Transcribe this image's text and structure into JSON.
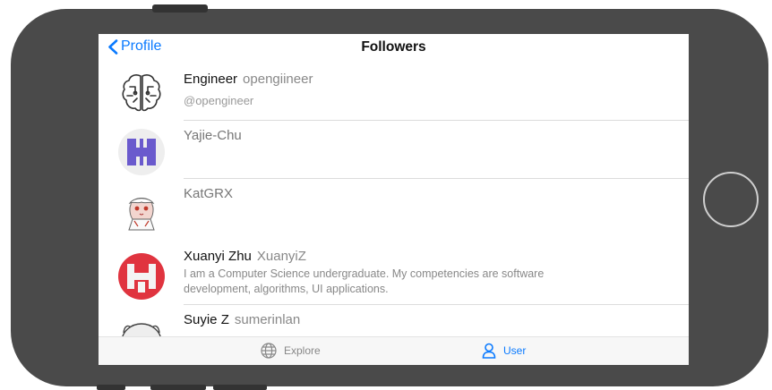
{
  "nav": {
    "back_label": "Profile",
    "title": "Followers"
  },
  "followers": [
    {
      "name": "Engineer",
      "login": "opengiineer",
      "subtitle": "@opengineer",
      "bio": ""
    },
    {
      "name": "Yajie-Chu",
      "login": "",
      "subtitle": "",
      "bio": ""
    },
    {
      "name": "KatGRX",
      "login": "",
      "subtitle": "",
      "bio": ""
    },
    {
      "name": "Xuanyi Zhu",
      "login": "XuanyiZ",
      "subtitle": "",
      "bio": "I am a Computer Science undergraduate. My competencies are software development, algorithms, UI applications."
    },
    {
      "name": "Suyie Z",
      "login": "sumerinlan",
      "subtitle": "",
      "bio": ""
    }
  ],
  "tabs": [
    {
      "label": "Explore",
      "icon": "globe-icon",
      "color": "#888888"
    },
    {
      "label": "User",
      "icon": "person-icon",
      "color": "#0a7aff"
    }
  ],
  "colors": {
    "accent": "#0a7aff",
    "avatar_purple": "#6a5acd",
    "avatar_red": "#e0343f",
    "device_body": "#4a4a4a"
  }
}
